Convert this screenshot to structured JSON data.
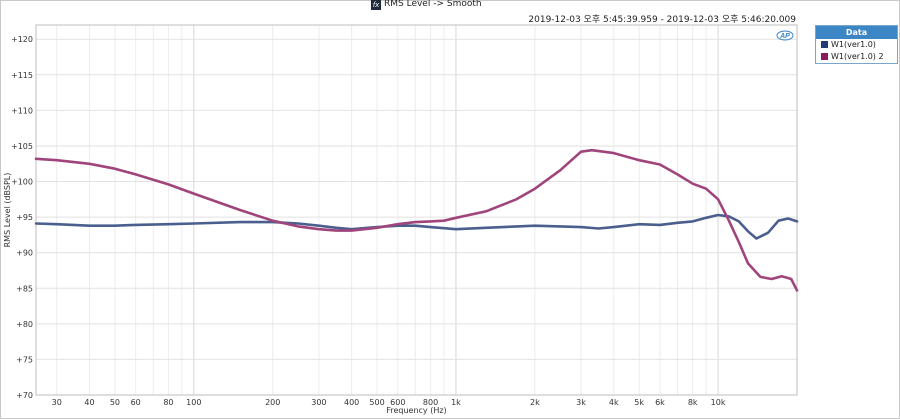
{
  "window": {
    "title": "RMS Level -> Smooth",
    "title_icon": "fx",
    "timestamp": "2019-12-03 오후 5:45:39.959 - 2019-12-03 오후 5:46:20.009"
  },
  "legend": {
    "header": "Data",
    "items": [
      {
        "label": "W1(ver1.0)",
        "color": "#1f3b73"
      },
      {
        "label": "W1(ver1.0) 2",
        "color": "#8b1a5a"
      }
    ]
  },
  "chart_data": {
    "type": "line",
    "xlabel": "Frequency (Hz)",
    "ylabel": "RMS Level (dBSPL)",
    "xscale": "log",
    "xlim": [
      25,
      20000
    ],
    "ylim": [
      70,
      122
    ],
    "yticks": [
      70,
      75,
      80,
      85,
      90,
      95,
      100,
      105,
      110,
      115,
      120
    ],
    "yticklabels": [
      "+70",
      "+75",
      "+80",
      "+85",
      "+90",
      "+95",
      "+100",
      "+105",
      "+110",
      "+115",
      "+120"
    ],
    "xticks": [
      30,
      40,
      50,
      60,
      80,
      100,
      200,
      300,
      400,
      500,
      600,
      800,
      1000,
      2000,
      3000,
      4000,
      5000,
      6000,
      8000,
      10000
    ],
    "xticklabels": [
      "30",
      "40",
      "50",
      "60",
      "80",
      "100",
      "200",
      "300",
      "400",
      "500",
      "600",
      "800",
      "1k",
      "2k",
      "3k",
      "4k",
      "5k",
      "6k",
      "8k",
      "10k"
    ],
    "grid": true,
    "series": [
      {
        "name": "W1(ver1.0)",
        "color": "#4a5f8e",
        "points": [
          [
            25,
            94.1
          ],
          [
            30,
            94.0
          ],
          [
            40,
            93.8
          ],
          [
            50,
            93.8
          ],
          [
            60,
            93.9
          ],
          [
            80,
            94.0
          ],
          [
            100,
            94.1
          ],
          [
            150,
            94.3
          ],
          [
            200,
            94.3
          ],
          [
            250,
            94.1
          ],
          [
            300,
            93.8
          ],
          [
            350,
            93.5
          ],
          [
            400,
            93.3
          ],
          [
            500,
            93.6
          ],
          [
            600,
            93.8
          ],
          [
            700,
            93.8
          ],
          [
            800,
            93.6
          ],
          [
            1000,
            93.3
          ],
          [
            1300,
            93.5
          ],
          [
            2000,
            93.8
          ],
          [
            3000,
            93.6
          ],
          [
            3500,
            93.4
          ],
          [
            4000,
            93.6
          ],
          [
            5000,
            94.0
          ],
          [
            6000,
            93.9
          ],
          [
            7000,
            94.2
          ],
          [
            8000,
            94.4
          ],
          [
            9000,
            94.9
          ],
          [
            10000,
            95.3
          ],
          [
            11000,
            95.1
          ],
          [
            12000,
            94.4
          ],
          [
            13000,
            93.0
          ],
          [
            14000,
            92.0
          ],
          [
            15500,
            92.8
          ],
          [
            17000,
            94.5
          ],
          [
            18500,
            94.8
          ],
          [
            20000,
            94.4
          ]
        ]
      },
      {
        "name": "W1(ver1.0) 2",
        "color": "#a0457c",
        "points": [
          [
            25,
            103.2
          ],
          [
            30,
            103.0
          ],
          [
            40,
            102.5
          ],
          [
            50,
            101.8
          ],
          [
            60,
            101.0
          ],
          [
            80,
            99.6
          ],
          [
            100,
            98.3
          ],
          [
            150,
            96.0
          ],
          [
            200,
            94.5
          ],
          [
            250,
            93.7
          ],
          [
            300,
            93.3
          ],
          [
            350,
            93.1
          ],
          [
            400,
            93.1
          ],
          [
            500,
            93.5
          ],
          [
            600,
            94.0
          ],
          [
            700,
            94.3
          ],
          [
            800,
            94.4
          ],
          [
            900,
            94.5
          ],
          [
            1000,
            94.9
          ],
          [
            1300,
            95.8
          ],
          [
            1700,
            97.5
          ],
          [
            2000,
            99.0
          ],
          [
            2500,
            101.6
          ],
          [
            3000,
            104.2
          ],
          [
            3300,
            104.4
          ],
          [
            4000,
            104.0
          ],
          [
            5000,
            103.0
          ],
          [
            6000,
            102.4
          ],
          [
            7000,
            101.0
          ],
          [
            8000,
            99.7
          ],
          [
            9000,
            99.0
          ],
          [
            10000,
            97.5
          ],
          [
            11000,
            94.5
          ],
          [
            12000,
            91.5
          ],
          [
            13000,
            88.5
          ],
          [
            14500,
            86.6
          ],
          [
            16000,
            86.3
          ],
          [
            17500,
            86.7
          ],
          [
            19000,
            86.3
          ],
          [
            20000,
            84.7
          ]
        ]
      }
    ]
  }
}
